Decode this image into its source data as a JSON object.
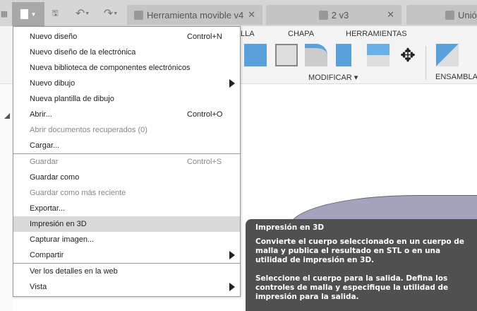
{
  "tabs": [
    {
      "label": "Herramienta movible v4"
    },
    {
      "label": "2 v3"
    },
    {
      "label": "Unió"
    }
  ],
  "ribbon": {
    "tabs": [
      "LLA",
      "CHAPA",
      "HERRAMIENTAS"
    ],
    "groups": [
      "MODIFICAR",
      "ENSAMBLAR"
    ]
  },
  "menu": {
    "items": [
      {
        "label": "Nuevo diseño",
        "shortcut": "Control+N"
      },
      {
        "label": "Nuevo diseño de la electrónica"
      },
      {
        "label": "Nueva biblioteca de componentes electrónicos"
      },
      {
        "label": "Nuevo dibujo",
        "submenu": true
      },
      {
        "label": "Nueva plantilla de dibujo"
      },
      {
        "label": "Abrir...",
        "shortcut": "Control+O"
      },
      {
        "label": "Abrir documentos recuperados (0)",
        "disabled": true
      },
      {
        "label": "Cargar..."
      },
      {
        "label": "Guardar",
        "shortcut": "Control+S",
        "disabled": true
      },
      {
        "label": "Guardar como"
      },
      {
        "label": "Guardar como más reciente",
        "disabled": true
      },
      {
        "label": "Exportar..."
      },
      {
        "label": "Impresión en 3D",
        "highlighted": true
      },
      {
        "label": "Capturar imagen..."
      },
      {
        "label": "Compartir",
        "submenu": true
      },
      {
        "label": "Ver los detalles en la web"
      },
      {
        "label": "Vista",
        "submenu": true
      }
    ]
  },
  "tooltip": {
    "title": "Impresión en 3D",
    "p1": "Convierte el cuerpo seleccionado en un cuerpo de malla y publica el resultado en STL o en una utilidad de impresión en 3D.",
    "p2": "Seleccione el cuerpo para la salida. Defina los controles de malla y especifique la utilidad de impresión para la salida."
  }
}
